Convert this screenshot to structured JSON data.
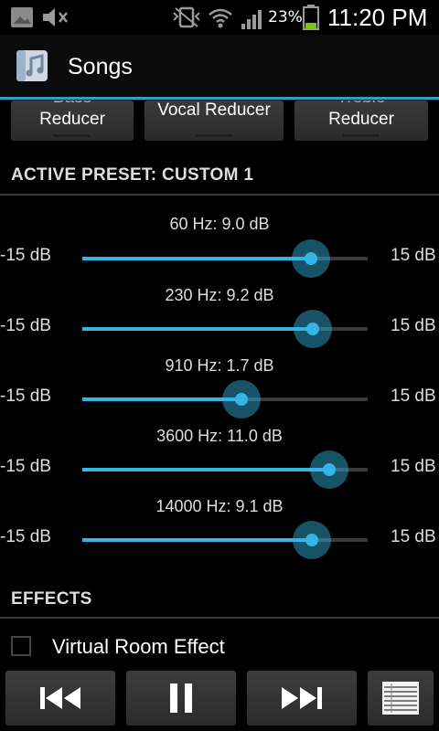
{
  "status_bar": {
    "battery_percent": "23%",
    "time": "11:20 PM",
    "icons": [
      "gallery-icon",
      "mute-icon",
      "vibrate-icon",
      "wifi-icon",
      "signal-icon",
      "battery-icon"
    ]
  },
  "action_bar": {
    "title": "Songs",
    "app_icon": "music-note-icon",
    "accent_color": "#2f9fc8"
  },
  "presets": [
    {
      "cut_text": "Bass",
      "label": "Reducer"
    },
    {
      "cut_text": "",
      "label": "Vocal Reducer"
    },
    {
      "cut_text": "Treble",
      "label": "Reducer"
    }
  ],
  "active_preset": {
    "header": "ACTIVE PRESET: CUSTOM 1"
  },
  "equalizer": {
    "min_label": "-15 dB",
    "max_label": "15 dB",
    "min_db": -15,
    "max_db": 15,
    "slider_color": "#35b5e5",
    "bands": [
      {
        "label": "60 Hz: 9.0 dB",
        "value_db": 9.0
      },
      {
        "label": "230 Hz: 9.2 dB",
        "value_db": 9.2
      },
      {
        "label": "910 Hz: 1.7 dB",
        "value_db": 1.7
      },
      {
        "label": "3600 Hz: 11.0 dB",
        "value_db": 11.0
      },
      {
        "label": "14000 Hz: 9.1 dB",
        "value_db": 9.1
      }
    ]
  },
  "effects": {
    "header": "EFFECTS",
    "virtual_room": {
      "label": "Virtual Room Effect",
      "checked": false
    }
  },
  "transport": {
    "buttons": [
      "previous-icon",
      "pause-icon",
      "next-icon",
      "playlist-icon"
    ]
  }
}
